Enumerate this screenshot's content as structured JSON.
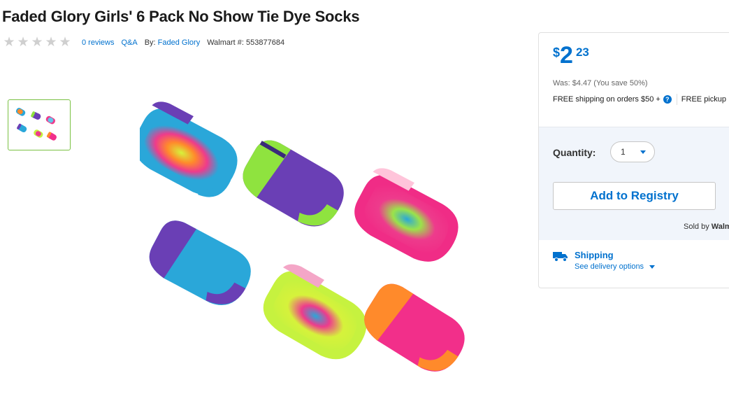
{
  "product": {
    "title": "Faded Glory Girls' 6 Pack No Show Tie Dye Socks",
    "rating_stars": 5,
    "reviews_link": "0 reviews",
    "qa_link": "Q&A",
    "by_label": "By:",
    "brand_link": "Faded Glory",
    "walmart_number": "Walmart #: 553877684"
  },
  "gallery": {
    "thumbnail_icon": "product-thumbnail-image",
    "main_image_icon": "tie-dye-socks-image"
  },
  "buybox": {
    "currency_symbol": "$",
    "price_dollars": "2",
    "price_cents": "23",
    "was_price": "Was: $4.47  (You save 50%)",
    "free_shipping": "FREE shipping on orders $50 +",
    "help_icon": "?",
    "free_pickup": "FREE pickup",
    "quantity_label": "Quantity:",
    "quantity_value": "1",
    "add_to_registry": "Add to Registry",
    "sold_by_prefix": "Sold by",
    "sold_by_name": "Walm",
    "shipping_title": "Shipping",
    "delivery_options": "See delivery options"
  },
  "colors": {
    "brand_blue": "#0071ce",
    "thumb_border": "#7ac143",
    "star_empty": "#cfcfcf"
  }
}
